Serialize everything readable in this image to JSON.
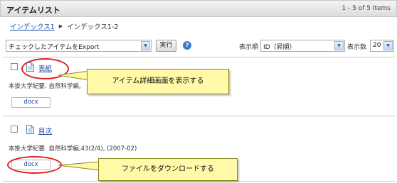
{
  "header": {
    "title": "アイテムリスト",
    "count": "1 - 5 of 5 Items"
  },
  "breadcrumb": {
    "link": "インデックス1",
    "current": "インデックス1-2"
  },
  "toolbar": {
    "action_select": "チェックしたアイテムをExport",
    "execute_label": "実行",
    "help_symbol": "?",
    "sort_label": "表示順",
    "sort_value": "ID（昇順）",
    "count_label": "表示数",
    "count_value": "20"
  },
  "items": [
    {
      "title": "表紙",
      "meta": "本掛大学紀要. 自然科学編,",
      "file_label": "docx"
    },
    {
      "title": "目次",
      "meta": "本掛大学紀要. 自然科学編,43(2/4), (2007-02)",
      "file_label": "docx"
    }
  ],
  "callouts": {
    "detail": "アイテム詳細画面を表示する",
    "download": "ファイルをダウンロードする"
  },
  "colors": {
    "link": "#1a4aa8",
    "callout_bg": "#fff9a8",
    "highlight": "#e02020"
  }
}
